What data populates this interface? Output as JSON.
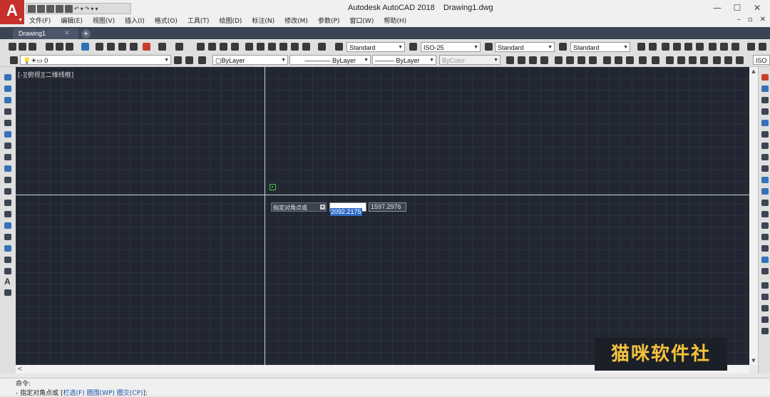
{
  "app": {
    "title": "Autodesk AutoCAD 2018",
    "file": "Drawing1.dwg",
    "logo_letter": "A",
    "colors": {
      "brand": "#c6302c",
      "canvas": "#212630",
      "highlight": "#2e6bc6",
      "crosshair": "#cfd3da",
      "pickbox": "#46c446",
      "watermark_text": "#f6c33c"
    }
  },
  "window_controls": {
    "minimize": "—",
    "maximize": "☐",
    "close": "✕"
  },
  "mdi_controls": {
    "minimize": "–",
    "restore": "▫",
    "close": "✕"
  },
  "menubar": {
    "items": [
      "文件(F)",
      "编辑(E)",
      "视图(V)",
      "插入(I)",
      "格式(O)",
      "工具(T)",
      "绘图(D)",
      "标注(N)",
      "修改(M)",
      "参数(P)",
      "窗口(W)",
      "帮助(H)"
    ]
  },
  "tabs": {
    "active": "Drawing1",
    "close": "✕",
    "new": "+"
  },
  "styles_toolbar": {
    "text_style": "Standard",
    "dim_style": "ISO-25",
    "table_style": "Standard",
    "multileader_style": "Standard"
  },
  "layers_toolbar": {
    "layer": "0",
    "color": "ByLayer",
    "linetype": "ByLayer",
    "lineweight": "ByLayer",
    "plotstyle": "ByColor",
    "right_combo": "ISO"
  },
  "viewport": {
    "label": "[-][俯视][二维线框]"
  },
  "dynamic_input": {
    "prompt": "指定对角点或",
    "x_value": "2092.2175",
    "y_value": "1597.2976"
  },
  "command": {
    "label": "命令:",
    "history_prefix": "- 指定对角点或 [",
    "option1": "栏选(F)",
    "option2": "圈围(WP)",
    "option3": "圈交(CP)",
    "history_suffix": "]:"
  },
  "watermark": {
    "text": "猫咪软件社"
  },
  "icons": [
    "save-icon",
    "open-icon",
    "new-icon",
    "print-icon",
    "undo-icon",
    "redo-icon",
    "pan-icon",
    "zoom-icon",
    "properties-icon",
    "text-style-icon",
    "dim-style-icon",
    "table-style-icon",
    "mleader-style-icon",
    "layer-icon",
    "line-icon",
    "circle-icon",
    "arc-icon",
    "polyline-icon",
    "hatch-icon",
    "move-icon",
    "copy-icon",
    "rotate-icon",
    "scale-icon",
    "mirror-icon",
    "erase-icon",
    "text-icon"
  ]
}
